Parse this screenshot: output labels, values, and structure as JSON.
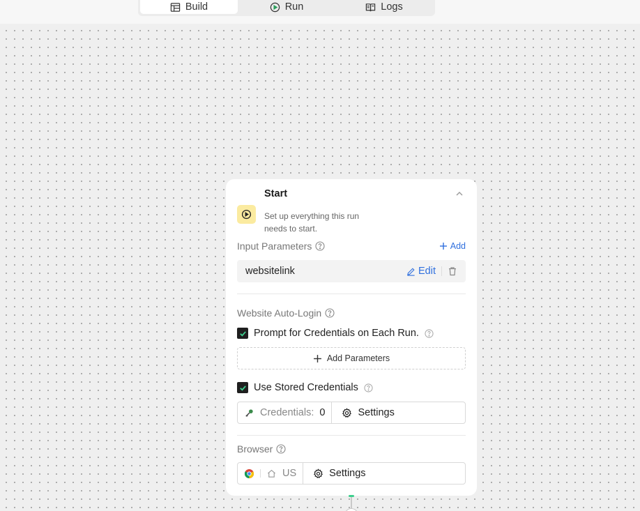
{
  "tabs": [
    {
      "label": "Build",
      "icon": "table-icon",
      "active": true
    },
    {
      "label": "Run",
      "icon": "play-circle-icon",
      "active": false
    },
    {
      "label": "Logs",
      "icon": "book-icon",
      "active": false
    }
  ],
  "node": {
    "title": "Start",
    "description": "Set up everything this run needs to start.",
    "input_parameters": {
      "label": "Input Parameters",
      "add_label": "Add",
      "items": [
        {
          "name": "websitelink",
          "edit_label": "Edit"
        }
      ]
    },
    "auto_login": {
      "label": "Website Auto-Login",
      "prompt_label": "Prompt for Credentials on Each Run.",
      "prompt_checked": true,
      "add_parameters_label": "Add Parameters",
      "stored_label": "Use Stored Credentials",
      "stored_checked": true,
      "credentials_label": "Credentials:",
      "credentials_count": "0",
      "settings_label": "Settings"
    },
    "browser": {
      "label": "Browser",
      "region": "US",
      "settings_label": "Settings"
    }
  },
  "colors": {
    "accent": "#2f6fde",
    "start_badge": "#fbeba0",
    "check_green": "#3ecf8e",
    "canvas": "#efefef"
  }
}
